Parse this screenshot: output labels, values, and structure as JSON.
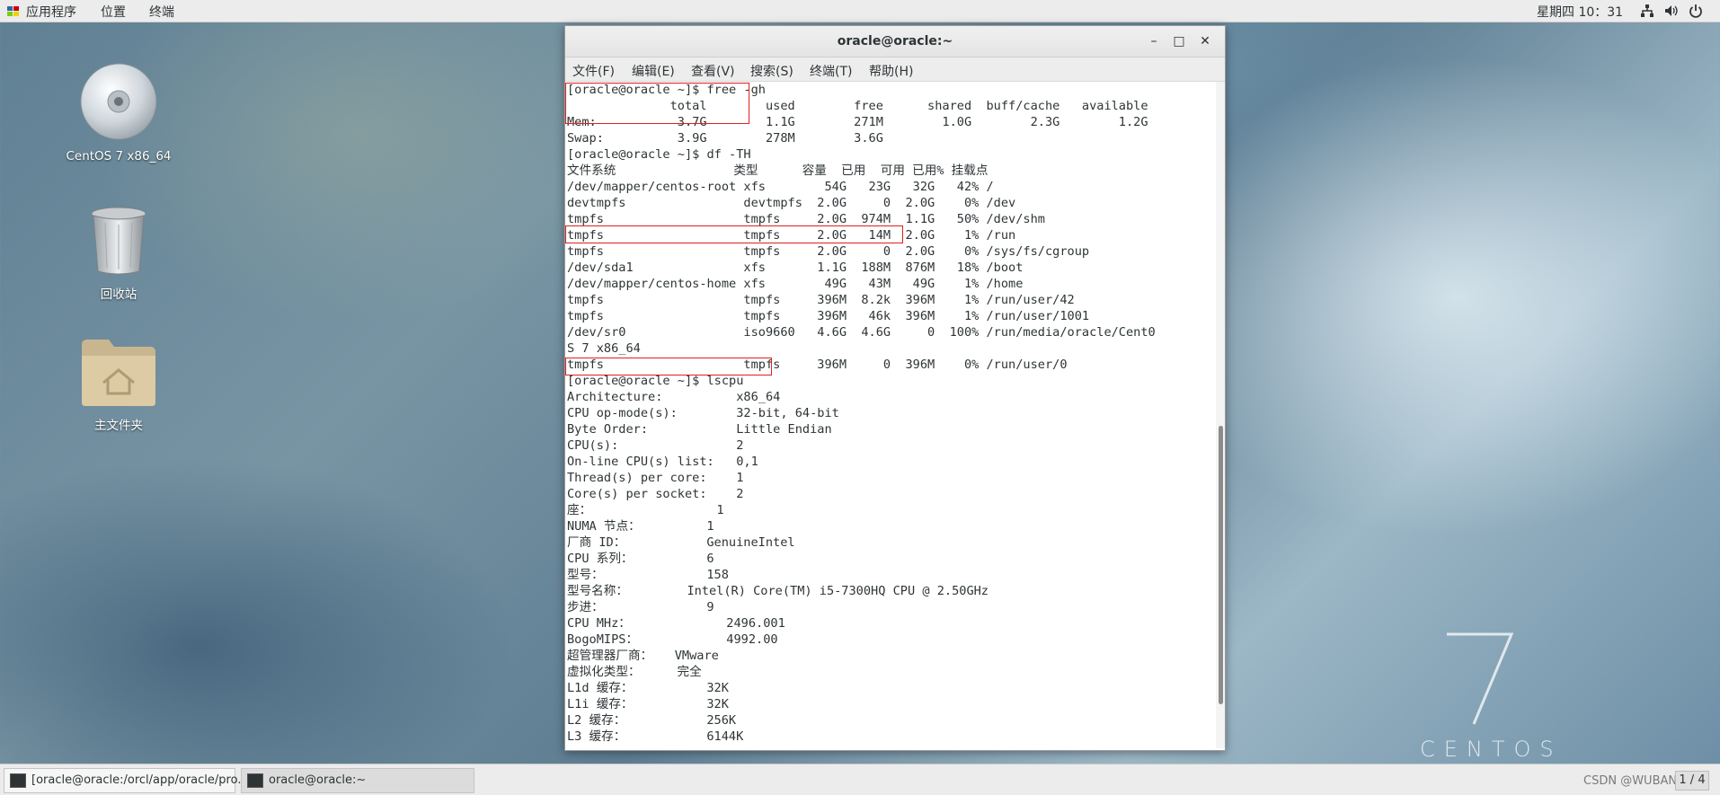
{
  "topbar": {
    "applications": "应用程序",
    "places": "位置",
    "terminal": "终端",
    "clock": "星期四 10：31"
  },
  "desktop": {
    "icons": [
      {
        "label": "CentOS 7 x86_64",
        "icon": "cd-disc-icon"
      },
      {
        "label": "回收站",
        "icon": "trash-icon"
      },
      {
        "label": "主文件夹",
        "icon": "home-folder-icon"
      }
    ],
    "watermark_numeral": "7",
    "watermark_word": "CENTOS"
  },
  "terminal": {
    "title": "oracle@oracle:~",
    "menu": [
      "文件(F)",
      "编辑(E)",
      "查看(V)",
      "搜索(S)",
      "终端(T)",
      "帮助(H)"
    ],
    "lines": [
      "[oracle@oracle ~]$ free -gh",
      "              total        used        free      shared  buff/cache   available",
      "Mem:           3.7G        1.1G        271M        1.0G        2.3G        1.2G",
      "Swap:          3.9G        278M        3.6G",
      "[oracle@oracle ~]$ df -TH",
      "文件系统                类型      容量  已用  可用 已用% 挂载点",
      "/dev/mapper/centos-root xfs        54G   23G   32G   42% /",
      "devtmpfs                devtmpfs  2.0G     0  2.0G    0% /dev",
      "tmpfs                   tmpfs     2.0G  974M  1.1G   50% /dev/shm",
      "tmpfs                   tmpfs     2.0G   14M  2.0G    1% /run",
      "tmpfs                   tmpfs     2.0G     0  2.0G    0% /sys/fs/cgroup",
      "/dev/sda1               xfs       1.1G  188M  876M   18% /boot",
      "/dev/mapper/centos-home xfs        49G   43M   49G    1% /home",
      "tmpfs                   tmpfs     396M  8.2k  396M    1% /run/user/42",
      "tmpfs                   tmpfs     396M   46k  396M    1% /run/user/1001",
      "/dev/sr0                iso9660   4.6G  4.6G     0  100% /run/media/oracle/Cent0",
      "S 7 x86_64",
      "tmpfs                   tmpfs     396M     0  396M    0% /run/user/0",
      "[oracle@oracle ~]$ lscpu",
      "Architecture:          x86_64",
      "CPU op-mode(s):        32-bit, 64-bit",
      "Byte Order:            Little Endian",
      "CPU(s):                2",
      "On-line CPU(s) list:   0,1",
      "Thread(s) per core:    1",
      "Core(s) per socket:    2",
      "座：                 1",
      "NUMA 节点：         1",
      "厂商 ID：           GenuineIntel",
      "CPU 系列：          6",
      "型号：              158",
      "型号名称：        Intel(R) Core(TM) i5-7300HQ CPU @ 2.50GHz",
      "步进：              9",
      "CPU MHz：             2496.001",
      "BogoMIPS：            4992.00",
      "超管理器厂商：   VMware",
      "虚拟化类型：     完全",
      "L1d 缓存：          32K",
      "L1i 缓存：          32K",
      "L2 缓存：           256K",
      "L3 缓存：           6144K"
    ]
  },
  "taskbar": {
    "tasks": [
      "[oracle@oracle:/orcl/app/oracle/pro...",
      "oracle@oracle:~"
    ],
    "watermark": "CSDN @WUBANTU",
    "workspace": "1 / 4"
  }
}
